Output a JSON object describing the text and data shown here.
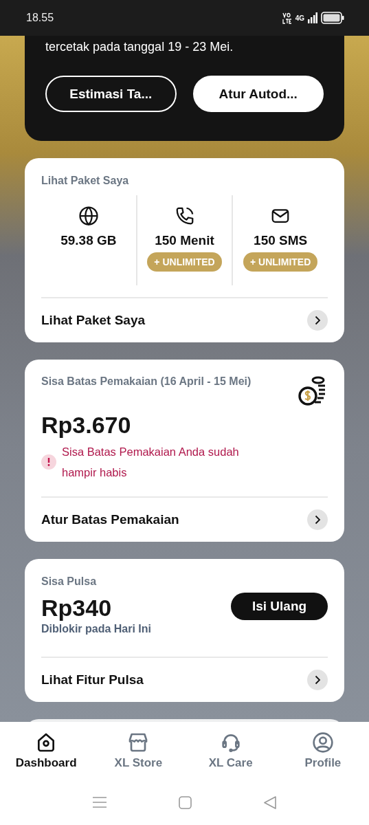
{
  "status_bar": {
    "time": "18.55",
    "network": "4G"
  },
  "promo_card": {
    "text": "tercetak pada tanggal 19 - 23 Mei.",
    "buttons": [
      {
        "label": "Estimasi Ta...",
        "kind": "outline"
      },
      {
        "label": "Atur Autod...",
        "kind": "filled"
      }
    ]
  },
  "package_card": {
    "title": "Lihat Paket Saya",
    "items": [
      {
        "kind": "data",
        "amount": "59.38 GB"
      },
      {
        "kind": "call",
        "amount": "150 Menit",
        "badge": "+ UNLIMITED"
      },
      {
        "kind": "sms",
        "amount": "150 SMS",
        "badge": "+ UNLIMITED"
      }
    ],
    "link": "Lihat Paket Saya"
  },
  "usage_card": {
    "title": "Sisa Batas Pemakaian (16 April - 15 Mei)",
    "amount": "Rp3.670",
    "warning": "Sisa Batas Pemakaian Anda sudah hampir habis",
    "link": "Atur Batas Pemakaian"
  },
  "credit_card": {
    "title": "Sisa Pulsa",
    "amount": "Rp340",
    "note": "Diblokir pada Hari Ini",
    "button": "Isi Ulang",
    "link": "Lihat Fitur Pulsa"
  },
  "bottom_nav": [
    {
      "kind": "home",
      "label": "Dashboard",
      "selected": true
    },
    {
      "kind": "store",
      "label": "XL Store",
      "selected": false
    },
    {
      "kind": "care",
      "label": "XL Care",
      "selected": false
    },
    {
      "kind": "profile",
      "label": "Profile",
      "selected": false
    }
  ]
}
